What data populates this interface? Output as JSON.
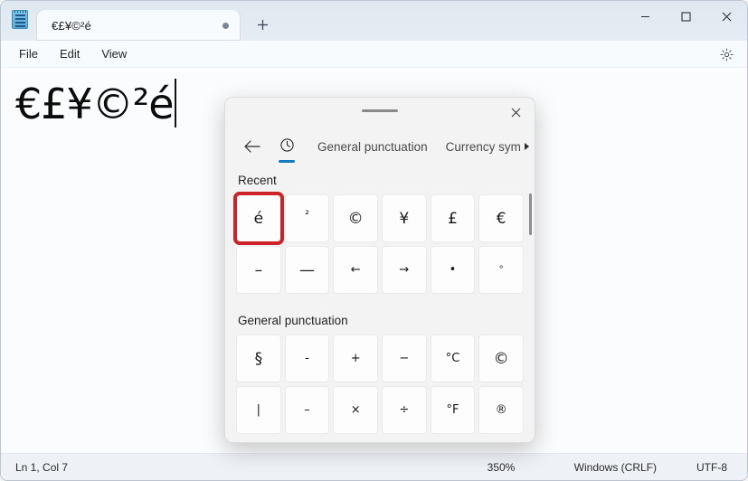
{
  "window": {
    "app_icon": "notepad-icon",
    "controls": {
      "minimize": "minimize-icon",
      "maximize": "maximize-icon",
      "close": "close-icon"
    }
  },
  "tabstrip": {
    "active_tab": {
      "title": "€£¥©²é",
      "modified_indicator": "unsaved-dot"
    },
    "new_tab_label": "+"
  },
  "menubar": {
    "items": [
      {
        "label": "File"
      },
      {
        "label": "Edit"
      },
      {
        "label": "View"
      }
    ],
    "settings_icon": "gear-icon"
  },
  "editor": {
    "text": "€£¥©²é"
  },
  "statusbar": {
    "position": "Ln 1, Col 7",
    "zoom": "350%",
    "line_ending": "Windows (CRLF)",
    "encoding": "UTF-8"
  },
  "panel": {
    "drag_handle": "drag-handle",
    "close_label": "✕",
    "tabs": {
      "back_label": "←",
      "items": [
        {
          "label": "",
          "icon": "clock-icon",
          "type": "icon",
          "selected": true
        },
        {
          "label": "General punctuation",
          "type": "text",
          "selected": false
        },
        {
          "label": "Currency sym",
          "type": "text",
          "selected": false,
          "truncated": true
        }
      ],
      "more_label": "▶"
    },
    "sections": [
      {
        "title": "Recent",
        "symbols": [
          {
            "char": "é",
            "name": "symbol-e-acute",
            "highlighted": true
          },
          {
            "char": "²",
            "name": "symbol-superscript-two",
            "style": "sup"
          },
          {
            "char": "©",
            "name": "symbol-copyright"
          },
          {
            "char": "¥",
            "name": "symbol-yen"
          },
          {
            "char": "£",
            "name": "symbol-pound"
          },
          {
            "char": "€",
            "name": "symbol-euro"
          },
          {
            "char": "–",
            "name": "symbol-en-dash"
          },
          {
            "char": "—",
            "name": "symbol-em-dash"
          },
          {
            "char": "←",
            "name": "symbol-left-arrow",
            "style": "small"
          },
          {
            "char": "→",
            "name": "symbol-right-arrow",
            "style": "small"
          },
          {
            "char": "•",
            "name": "symbol-bullet",
            "style": "small"
          },
          {
            "char": "°",
            "name": "symbol-degree",
            "style": "tiny"
          }
        ]
      },
      {
        "title": "General punctuation",
        "symbols": [
          {
            "char": "§",
            "name": "symbol-section-sign"
          },
          {
            "char": "-",
            "name": "symbol-hyphen",
            "style": "small"
          },
          {
            "char": "+",
            "name": "symbol-plus",
            "style": "small"
          },
          {
            "char": "−",
            "name": "symbol-minus",
            "style": "small"
          },
          {
            "char": "°C",
            "name": "symbol-degree-celsius",
            "style": "small"
          },
          {
            "char": "©",
            "name": "symbol-copyright-2"
          },
          {
            "char": "|",
            "name": "symbol-vertical-bar",
            "style": "small"
          },
          {
            "char": "–",
            "name": "symbol-en-dash-2",
            "style": "small"
          },
          {
            "char": "×",
            "name": "symbol-multiplication",
            "style": "small"
          },
          {
            "char": "÷",
            "name": "symbol-division",
            "style": "small"
          },
          {
            "char": "°F",
            "name": "symbol-degree-fahrenheit",
            "style": "small"
          },
          {
            "char": "®",
            "name": "symbol-registered",
            "style": "small"
          }
        ]
      }
    ]
  }
}
